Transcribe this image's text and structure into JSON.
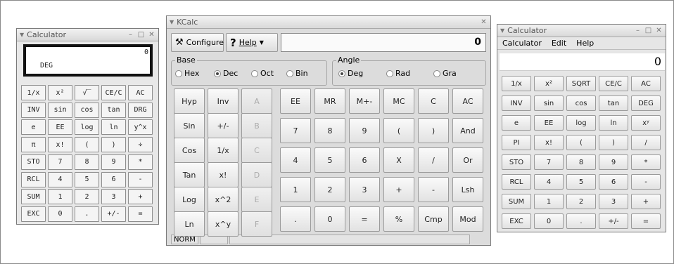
{
  "calc_left": {
    "title": "Calculator",
    "display_value": "0",
    "display_mode": "DEG",
    "buttons": [
      "1/x",
      "x²",
      "√‾",
      "CE/C",
      "AC",
      "INV",
      "sin",
      "cos",
      "tan",
      "DRG",
      "e",
      "EE",
      "log",
      "ln",
      "y^x",
      "π",
      "x!",
      "(",
      ")",
      "÷",
      "STO",
      "7",
      "8",
      "9",
      "*",
      "RCL",
      "4",
      "5",
      "6",
      "-",
      "SUM",
      "1",
      "2",
      "3",
      "+",
      "EXC",
      "0",
      ".",
      "+/-",
      "="
    ]
  },
  "kcalc": {
    "title": "KCalc",
    "configure_label": "Configure",
    "help_label": "Help",
    "display_value": "0",
    "base": {
      "label": "Base",
      "options": [
        "Hex",
        "Dec",
        "Oct",
        "Bin"
      ],
      "selected": "Dec"
    },
    "angle": {
      "label": "Angle",
      "options": [
        "Deg",
        "Rad",
        "Gra"
      ],
      "selected": "Deg"
    },
    "fn_buttons": [
      "Hyp",
      "Inv",
      "A",
      "Sin",
      "+/-",
      "B",
      "Cos",
      "1/x",
      "C",
      "Tan",
      "x!",
      "D",
      "Log",
      "x^2",
      "E",
      "Ln",
      "x^y",
      "F"
    ],
    "main_buttons": [
      "EE",
      "MR",
      "M+-",
      "MC",
      "C",
      "AC",
      "7",
      "8",
      "9",
      "(",
      ")",
      "And",
      "4",
      "5",
      "6",
      "X",
      "/",
      "Or",
      "1",
      "2",
      "3",
      "+",
      "-",
      "Lsh",
      ".",
      "0",
      "=",
      "%",
      "Cmp",
      "Mod"
    ],
    "status_mode": "NORM"
  },
  "calc_right": {
    "title": "Calculator",
    "menu": [
      "Calculator",
      "Edit",
      "Help"
    ],
    "display_value": "0",
    "buttons": [
      "1/x",
      "x²",
      "SQRT",
      "CE/C",
      "AC",
      "INV",
      "sin",
      "cos",
      "tan",
      "DEG",
      "e",
      "EE",
      "log",
      "ln",
      "xʸ",
      "PI",
      "x!",
      "(",
      ")",
      "/",
      "STO",
      "7",
      "8",
      "9",
      "*",
      "RCL",
      "4",
      "5",
      "6",
      "-",
      "SUM",
      "1",
      "2",
      "3",
      "+",
      "EXC",
      "0",
      ".",
      "+/-",
      "="
    ]
  }
}
